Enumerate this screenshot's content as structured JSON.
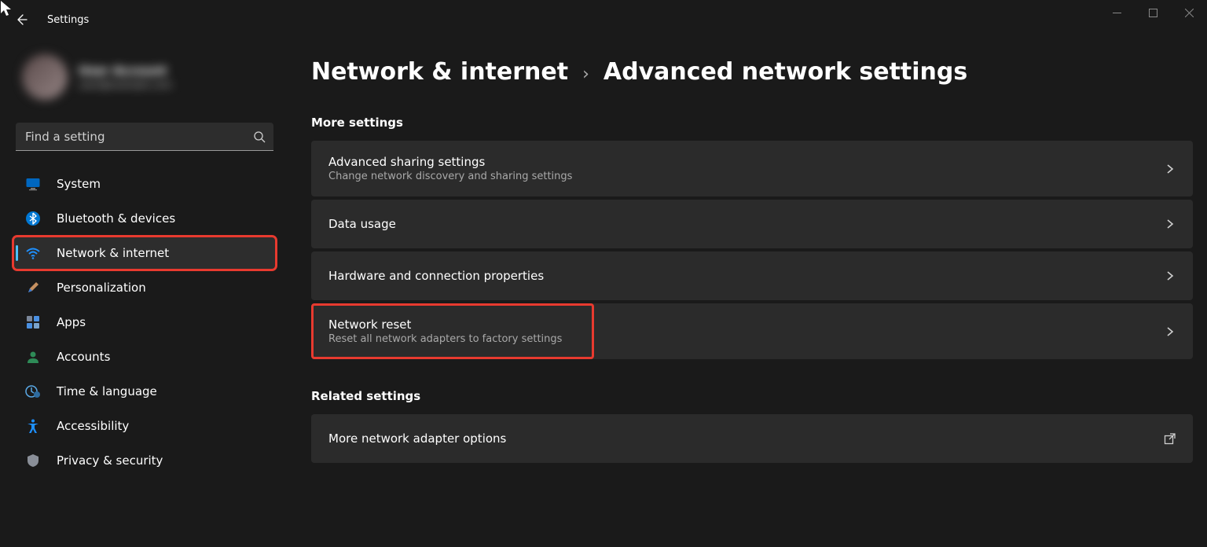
{
  "window": {
    "app_title": "Settings"
  },
  "user": {
    "name": "User Account",
    "email": "user@example.com"
  },
  "search": {
    "placeholder": "Find a setting"
  },
  "sidebar": {
    "items": [
      {
        "label": "System",
        "icon": "monitor-icon"
      },
      {
        "label": "Bluetooth & devices",
        "icon": "bluetooth-icon"
      },
      {
        "label": "Network & internet",
        "icon": "wifi-icon",
        "active": true,
        "highlight": true
      },
      {
        "label": "Personalization",
        "icon": "brush-icon"
      },
      {
        "label": "Apps",
        "icon": "apps-icon"
      },
      {
        "label": "Accounts",
        "icon": "person-icon"
      },
      {
        "label": "Time & language",
        "icon": "clock-globe-icon"
      },
      {
        "label": "Accessibility",
        "icon": "accessibility-icon"
      },
      {
        "label": "Privacy & security",
        "icon": "shield-icon"
      }
    ]
  },
  "breadcrumb": {
    "parent": "Network & internet",
    "current": "Advanced network settings"
  },
  "sections": {
    "more_settings": {
      "title": "More settings",
      "cards": [
        {
          "title": "Advanced sharing settings",
          "sub": "Change network discovery and sharing settings",
          "chevron": true
        },
        {
          "title": "Data usage",
          "sub": "",
          "chevron": true
        },
        {
          "title": "Hardware and connection properties",
          "sub": "",
          "chevron": true
        },
        {
          "title": "Network reset",
          "sub": "Reset all network adapters to factory settings",
          "chevron": true,
          "highlight": true
        }
      ]
    },
    "related_settings": {
      "title": "Related settings",
      "cards": [
        {
          "title": "More network adapter options",
          "sub": "",
          "external": true
        }
      ]
    }
  }
}
